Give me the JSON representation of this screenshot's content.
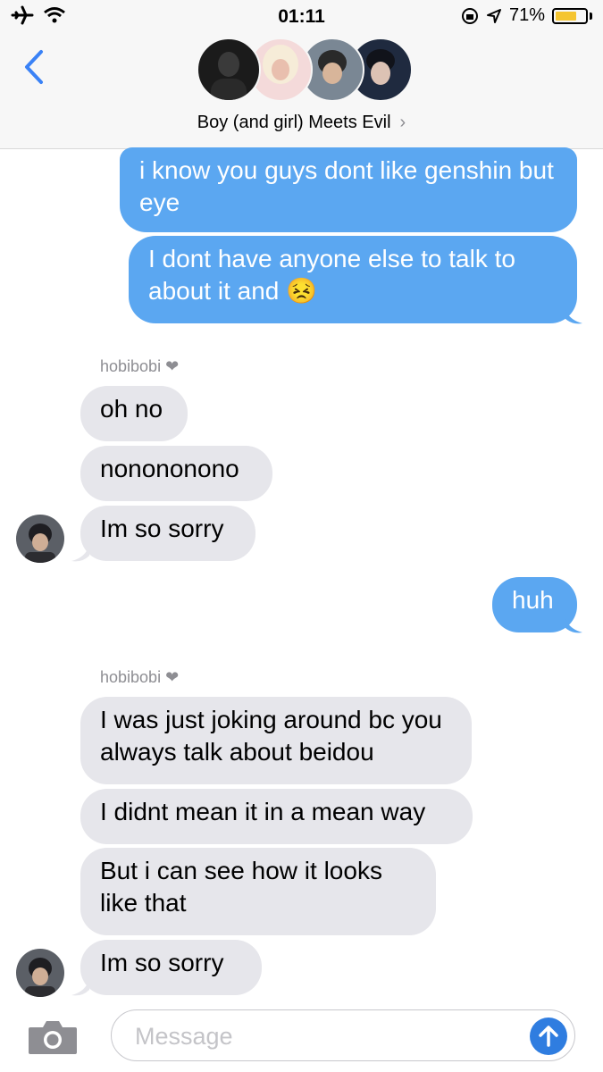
{
  "status_bar": {
    "time": "01:11",
    "battery_percent": "71%",
    "battery_level": 0.71,
    "battery_color": "#f5c531"
  },
  "header": {
    "group_name": "Boy (and girl) Meets Evil",
    "chevron": "›"
  },
  "messages": [
    {
      "side": "out",
      "text": "i know you guys dont like genshin but eye"
    },
    {
      "side": "out",
      "text": "I dont have anyone else to talk to about it and 😣"
    },
    {
      "sender": "hobibobi ❤"
    },
    {
      "side": "in",
      "text": "oh no"
    },
    {
      "side": "in",
      "text": "nonononono"
    },
    {
      "side": "in",
      "text": "Im so sorry"
    },
    {
      "side": "out",
      "text": "huh"
    },
    {
      "sender": "hobibobi ❤"
    },
    {
      "side": "in",
      "text": "I was just joking around bc you always talk about beidou"
    },
    {
      "side": "in",
      "text": "I didnt mean it in a mean way"
    },
    {
      "side": "in",
      "text": "But i can see how it looks like that"
    },
    {
      "side": "in",
      "text": "Im so sorry"
    }
  ],
  "composer": {
    "placeholder": "Message"
  },
  "colors": {
    "outgoing": "#5ba7f1",
    "incoming": "#e6e6eb",
    "send_button": "#2f7de0"
  }
}
